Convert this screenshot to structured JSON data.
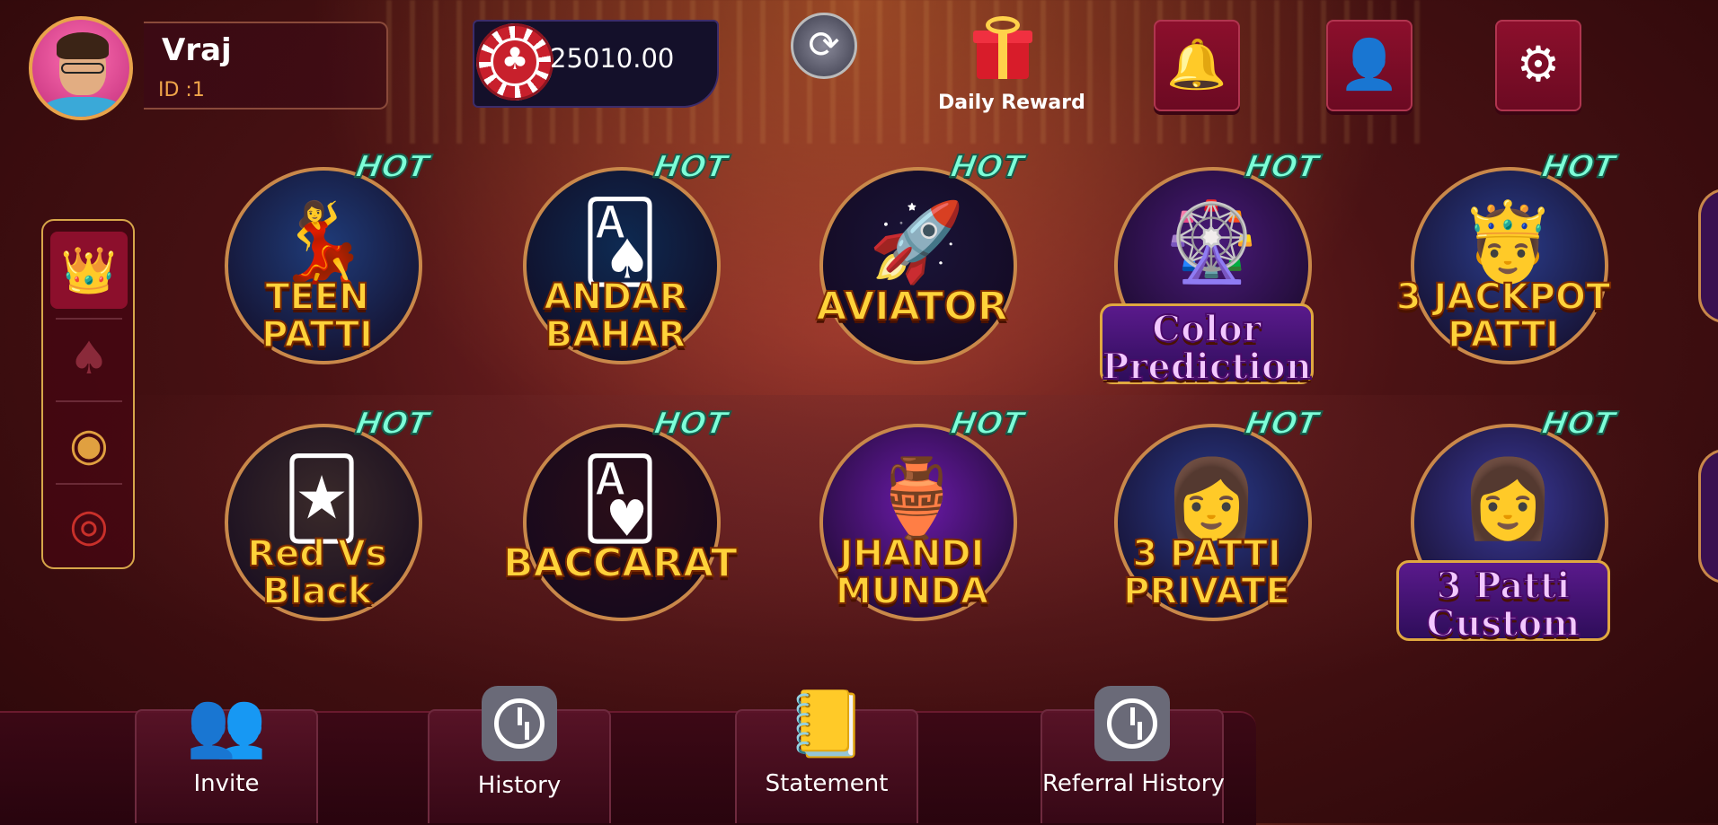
{
  "header": {
    "username": "Vraj",
    "user_id": "ID :1",
    "balance": "25010.00",
    "chip_symbol": "♣",
    "refresh_symbol": "⟳",
    "daily_reward_label": "Daily Reward",
    "buttons": [
      {
        "name": "notifications-button",
        "icon": "bell-icon",
        "glyph": "🔔"
      },
      {
        "name": "support-button",
        "icon": "headset-icon",
        "glyph": "👤"
      },
      {
        "name": "settings-button",
        "icon": "gear-icon",
        "glyph": "⚙"
      }
    ]
  },
  "sidebar": {
    "items": [
      {
        "name": "crown-icon",
        "glyph": "👑",
        "active": true
      },
      {
        "name": "card-suits-icon",
        "glyph": "♠",
        "active": false
      },
      {
        "name": "chip-icon",
        "glyph": "◉",
        "active": false
      },
      {
        "name": "roulette-icon",
        "glyph": "◎",
        "active": false
      }
    ]
  },
  "games": [
    {
      "id": "teen-patti",
      "lines": [
        "TEEN",
        "PATTI"
      ],
      "hot": "HOT",
      "art": "💃",
      "color": "#1f3c7a",
      "banner": false
    },
    {
      "id": "andar-bahar",
      "lines": [
        "ANDAR",
        "BAHAR"
      ],
      "hot": "HOT",
      "art": "🂡",
      "color": "#0e2a52",
      "banner": false
    },
    {
      "id": "aviator",
      "lines": [
        "AVIATOR"
      ],
      "hot": "HOT",
      "art": "🚀",
      "color": "#1a1438",
      "banner": false
    },
    {
      "id": "color-prediction",
      "lines": [
        "Color",
        "Prediction"
      ],
      "hot": "HOT",
      "art": "🎡",
      "color": "#4a1a7a",
      "banner": true
    },
    {
      "id": "jackpot-patti",
      "lines": [
        "3 JACKPOT",
        "PATTI"
      ],
      "hot": "HOT",
      "art": "🤴",
      "color": "#2a3c8a",
      "banner": false
    },
    {
      "id": "red-vs-black",
      "lines": [
        "Red Vs",
        "Black"
      ],
      "hot": "HOT",
      "art": "🃏",
      "color": "#3a2a2a",
      "banner": false
    },
    {
      "id": "baccarat",
      "lines": [
        "BACCARAT"
      ],
      "hot": "HOT",
      "art": "🂱",
      "color": "#2a0e18",
      "banner": false
    },
    {
      "id": "jhandi-munda",
      "lines": [
        "JHANDI",
        "MUNDA"
      ],
      "hot": "HOT",
      "art": "🏺",
      "color": "#6a1aa8",
      "banner": false
    },
    {
      "id": "3-patti-private",
      "lines": [
        "3 PATTI",
        "PRIVATE"
      ],
      "hot": "HOT",
      "art": "👩",
      "color": "#2a3a8a",
      "banner": false
    },
    {
      "id": "3-patti-custom",
      "lines": [
        "3 Patti",
        "Custom"
      ],
      "hot": "HOT",
      "art": "👩",
      "color": "#3a3a9a",
      "banner": true
    }
  ],
  "bottom_nav": [
    {
      "name": "nav-invite",
      "label": "Invite",
      "icon": "invite-icon",
      "glyph": "👥"
    },
    {
      "name": "nav-history",
      "label": "History",
      "icon": "clock-icon",
      "glyph": ""
    },
    {
      "name": "nav-statement",
      "label": "Statement",
      "icon": "statement-icon",
      "glyph": "📒"
    },
    {
      "name": "nav-referral-history",
      "label": "Referral History",
      "icon": "clock-icon",
      "glyph": ""
    }
  ]
}
